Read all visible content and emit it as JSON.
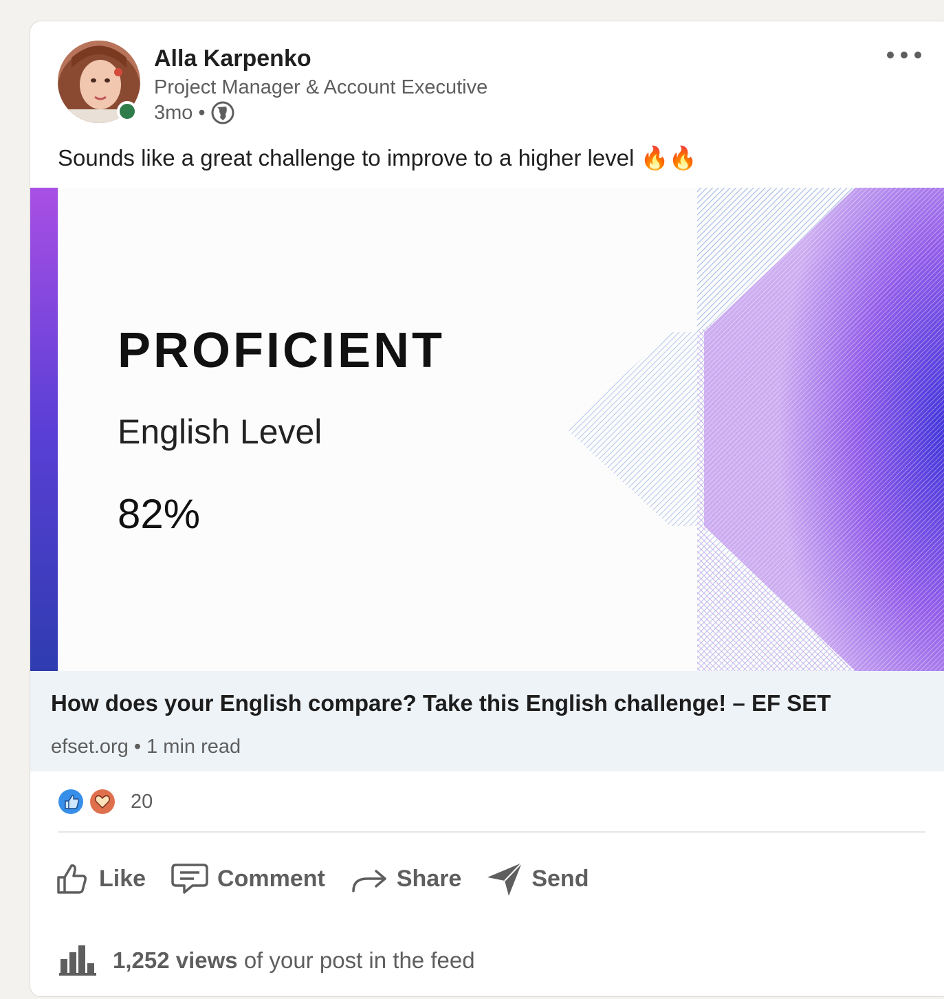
{
  "post": {
    "author": {
      "name": "Alla Karpenko",
      "headline": "Project Manager & Account Executive",
      "time": "3mo",
      "separator": "•",
      "visibility_icon": "globe-icon"
    },
    "more_icon": "more-horizontal-icon",
    "text": "Sounds like a great challenge to improve to a higher level 🔥🔥"
  },
  "banner": {
    "level": "PROFICIENT",
    "subtitle": "English Level",
    "percent": "82%"
  },
  "link": {
    "title": "How does your English compare? Take this English challenge! – EF SET",
    "source": "efset.org • 1 min read"
  },
  "reactions": {
    "icons": [
      "like-reaction-icon",
      "love-reaction-icon"
    ],
    "count": "20"
  },
  "actions": [
    {
      "label": "Like",
      "icon": "thumbs-up-icon"
    },
    {
      "label": "Comment",
      "icon": "comment-icon"
    },
    {
      "label": "Share",
      "icon": "share-arrow-icon"
    },
    {
      "label": "Send",
      "icon": "send-icon"
    }
  ],
  "views": {
    "count": "1,252 views",
    "suffix": " of your post in the feed",
    "icon": "bar-chart-icon"
  },
  "colors": {
    "presence": "#2f7d4a",
    "accent_purple": "#6a3de0",
    "link_bg": "#eef3f8"
  }
}
